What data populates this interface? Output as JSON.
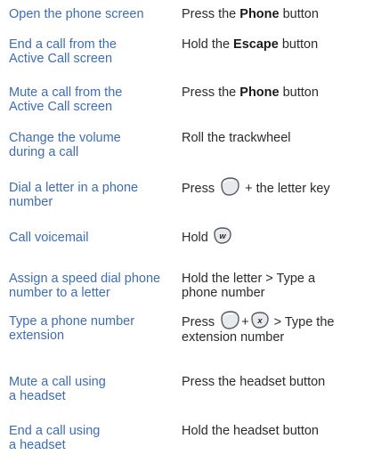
{
  "rows": [
    {
      "task": "Open the phone screen",
      "action": {
        "prefix": "Press the ",
        "bold": "Phone",
        "suffix": " button"
      }
    },
    {
      "task_line1": "End a call from the",
      "task_line2": "Active Call screen",
      "action": {
        "prefix": "Hold the ",
        "bold": "Escape",
        "suffix": " button"
      }
    },
    {
      "task_line1": "Mute a call from the",
      "task_line2": "Active Call screen",
      "action": {
        "prefix": "Press the ",
        "bold": "Phone",
        "suffix": " button"
      }
    },
    {
      "task_line1": "Change the volume",
      "task_line2": "during a call",
      "action": {
        "text": "Roll the trackwheel"
      }
    },
    {
      "task_line1": "Dial a letter in a phone",
      "task_line2": "number",
      "action": {
        "prefix": "Press",
        "suffix": "+ the letter key",
        "key": "alt-key-icon"
      }
    },
    {
      "task": "Call voicemail",
      "action": {
        "prefix": "Hold",
        "key": "w-key-icon",
        "key_letter": "W"
      }
    },
    {
      "task_line1": "Assign a speed dial phone",
      "task_line2": "number to a letter",
      "action": {
        "line1": "Hold the letter > Type a",
        "line2": "phone number"
      }
    },
    {
      "task_line1": "Type a phone number",
      "task_line2": "extension",
      "action": {
        "prefix": "Press",
        "plus": "+",
        "suffix": "> Type the",
        "line2": "extension number",
        "key1": "alt-key-icon",
        "key2": "x-key-icon",
        "key2_letter": "X"
      }
    },
    {
      "task_line1": "Mute a call using",
      "task_line2": "a headset",
      "action": {
        "text": "Press the headset button"
      }
    },
    {
      "task_line1": "End a call using",
      "task_line2": "a headset",
      "action": {
        "text": "Hold the headset button"
      }
    }
  ],
  "colors": {
    "task_text": "#3d6db5",
    "action_text": "#2b2b2b",
    "key_fill": "#e8e9ec",
    "key_outline": "#555a63"
  }
}
